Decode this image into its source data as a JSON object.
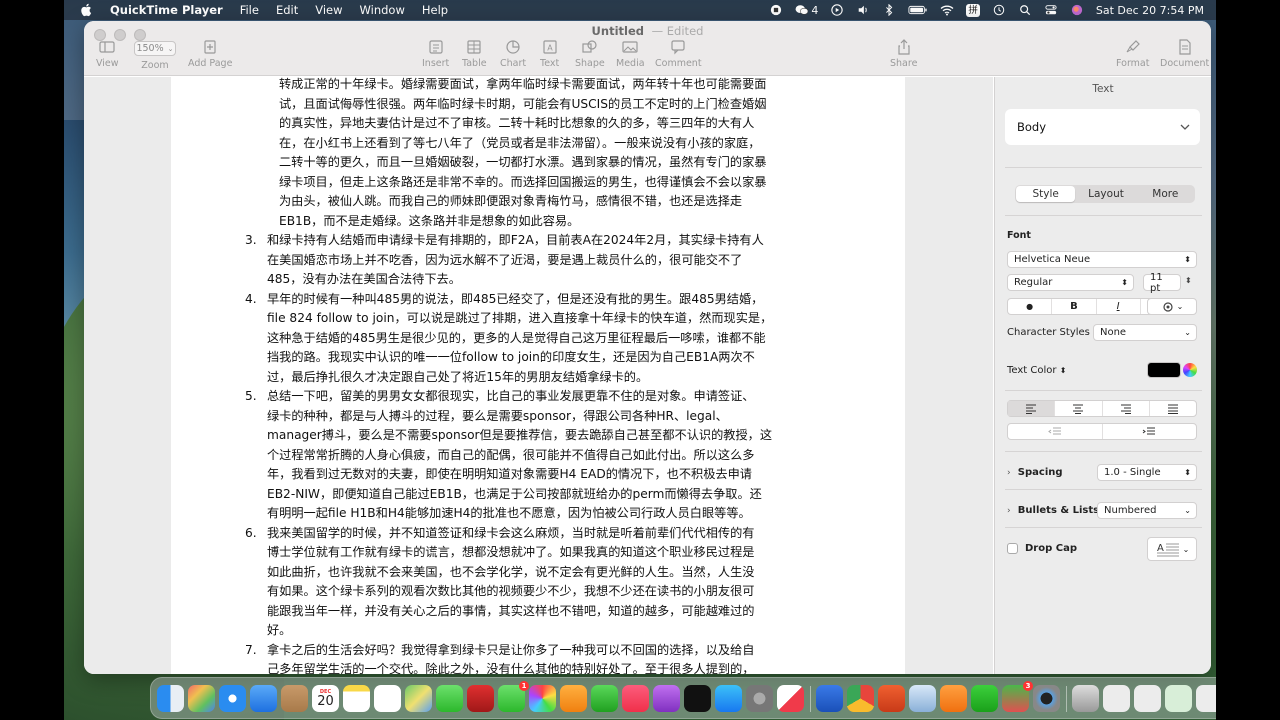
{
  "menubar": {
    "app_name": "QuickTime Player",
    "menus": [
      "File",
      "Edit",
      "View",
      "Window",
      "Help"
    ],
    "wechat_count": "4",
    "input_method": "拼",
    "datetime": "Sat Dec 20  7:54 PM"
  },
  "window": {
    "title": "Untitled",
    "title_suffix": "— Edited"
  },
  "toolbar": {
    "view": "View",
    "zoom_value": "150%",
    "zoom": "Zoom",
    "add_page": "Add Page",
    "insert": "Insert",
    "table": "Table",
    "chart": "Chart",
    "text": "Text",
    "shape": "Shape",
    "media": "Media",
    "comment": "Comment",
    "share": "Share",
    "format": "Format",
    "document": "Document"
  },
  "document": {
    "lines_top": [
      "转成正常的十年绿卡。婚绿需要面试，拿两年临时绿卡需要面试，两年转十年也可能需要面",
      "试，且面试侮辱性很强。两年临时绿卡时期，可能会有USCIS的员工不定时的上门检查婚姻",
      "的真实性，异地夫妻估计是过不了审核。二转十耗时比想象的久的多，等三四年的大有人",
      "在，在小红书上还看到了等七八年了（党员或者是非法滞留）。一般来说没有小孩的家庭，",
      "二转十等的更久，而且一旦婚姻破裂，一切都打水漂。遇到家暴的情况，虽然有专门的家暴",
      "绿卡项目，但走上这条路还是非常不幸的。而选择回国搬运的男生，也得谨慎会不会以家暴",
      "为由头，被仙人跳。而我自己的师妹即便跟对象青梅竹马，感情很不错，也还是选择走",
      "EB1B，而不是走婚绿。这条路并非是想象的如此容易。"
    ],
    "items": [
      {
        "num": "3.",
        "lines": [
          "和绿卡持有人结婚而申请绿卡是有排期的，即F2A，目前表A在2024年2月，其实绿卡持有人",
          "在美国婚恋市场上并不吃香，因为远水解不了近渴，要是遇上裁员什么的，很可能交不了",
          "485，没有办法在美国合法待下去。"
        ]
      },
      {
        "num": "4.",
        "lines": [
          "早年的时候有一种叫485男的说法，即485已经交了，但是还没有批的男生。跟485男结婚，",
          "file 824 follow to join，可以说是跳过了排期，进入直接拿十年绿卡的快车道，然而现实是，",
          "这种急于结婚的485男生是很少见的，更多的人是觉得自己这万里征程最后一哆嗦，谁都不能",
          "挡我的路。我现实中认识的唯一一位follow to join的印度女生，还是因为自己EB1A两次不",
          "过，最后挣扎很久才决定跟自己处了将近15年的男朋友结婚拿绿卡的。"
        ]
      },
      {
        "num": "5.",
        "lines": [
          "总结一下吧，留美的男男女女都很现实，比自己的事业发展更靠不住的是对象。申请签证、",
          "绿卡的种种，都是与人搏斗的过程，要么是需要sponsor，得跟公司各种HR、legal、",
          "manager搏斗，要么是不需要sponsor但是要推荐信，要去跪舔自己甚至都不认识的教授，这",
          "个过程常常折腾的人身心俱疲，而自己的配偶，很可能并不值得自己如此付出。所以这么多",
          "年，我看到过无数对的夫妻，即使在明明知道对象需要H4 EAD的情况下，也不积极去申请",
          "EB2-NIW，即便知道自己能过EB1B，也满足于公司按部就班给办的perm而懒得去争取。还",
          "有明明一起file H1B和H4能够加速H4的批准也不愿意，因为怕被公司行政人员白眼等等。"
        ]
      },
      {
        "num": "6.",
        "lines": [
          "我来美国留学的时候，并不知道签证和绿卡会这么麻烦，当时就是听着前辈们代代相传的有",
          "博士学位就有工作就有绿卡的谎言，想都没想就冲了。如果我真的知道这个职业移民过程是",
          "如此曲折，也许我就不会来美国，也不会学化学，说不定会有更光鲜的人生。当然，人生没",
          "有如果。这个绿卡系列的观看次数比其他的视频要少不少，我想不少还在读书的小朋友很可",
          "能跟我当年一样，并没有关心之后的事情，其实这样也不错吧，知道的越多，可能越难过的",
          "好。"
        ]
      },
      {
        "num": "7.",
        "lines": [
          "拿卡之后的生活会好吗？我觉得拿到绿卡只是让你多了一种我可以不回国的选择，以及给自",
          "己多年留学生活的一个交代。除此之外，没有什么其他的特别好处了。至于很多人提到的，"
        ]
      }
    ]
  },
  "inspector": {
    "title": "Text",
    "paragraph_style": "Body",
    "tabs": [
      "Style",
      "Layout",
      "More"
    ],
    "font_label": "Font",
    "font_family": "Helvetica Neue",
    "font_weight": "Regular",
    "font_size": "11 pt",
    "bold": "B",
    "italic": "I",
    "underline": "U",
    "strike": "U",
    "character_styles_label": "Character Styles",
    "character_styles_value": "None",
    "text_color_label": "Text Color",
    "text_color": "#000000",
    "spacing_label": "Spacing",
    "spacing_value": "1.0 - Single",
    "bullets_label": "Bullets & Lists",
    "bullets_value": "Numbered",
    "drop_cap_label": "Drop Cap"
  },
  "dock": {
    "calendar_month": "DEC",
    "calendar_day": "20",
    "facetime_badge": "1",
    "wechat_badge": "3"
  }
}
